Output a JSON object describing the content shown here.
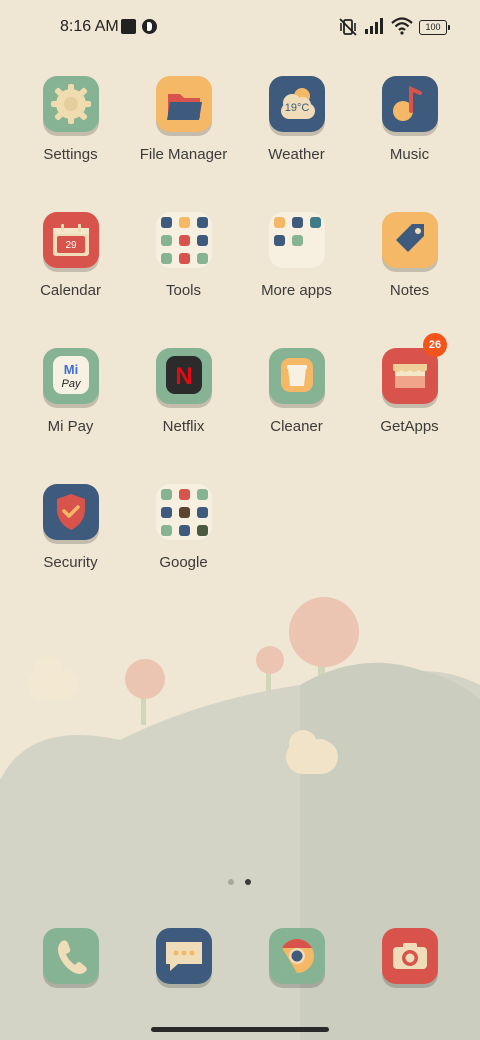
{
  "status_bar": {
    "time": "8:16 AM",
    "battery": "100",
    "icons": [
      "stop-square-icon",
      "circle-app-icon",
      "vibrate-off-icon",
      "signal-icon",
      "wifi-icon",
      "battery-icon"
    ]
  },
  "apps": [
    {
      "label": "Settings",
      "icon": "gear-icon"
    },
    {
      "label": "File Manager",
      "icon": "folder-icon"
    },
    {
      "label": "Weather",
      "icon": "cloud-icon",
      "temp": "19°C"
    },
    {
      "label": "Music",
      "icon": "music-note-icon"
    },
    {
      "label": "Calendar",
      "icon": "calendar-icon",
      "date": "29"
    },
    {
      "label": "Tools",
      "icon": "folder-grid-icon"
    },
    {
      "label": "More apps",
      "icon": "folder-grid-icon"
    },
    {
      "label": "Notes",
      "icon": "tag-icon"
    },
    {
      "label": "Mi Pay",
      "icon": "mi-pay-icon",
      "logo_top": "Mi",
      "logo_bottom": "Pay"
    },
    {
      "label": "Netflix",
      "icon": "netflix-icon",
      "logo": "N"
    },
    {
      "label": "Cleaner",
      "icon": "trash-icon"
    },
    {
      "label": "GetApps",
      "icon": "store-icon",
      "badge": "26"
    },
    {
      "label": "Security",
      "icon": "shield-icon"
    },
    {
      "label": "Google",
      "icon": "folder-grid-icon"
    }
  ],
  "dock": [
    {
      "name": "Phone",
      "icon": "phone-icon"
    },
    {
      "name": "Messages",
      "icon": "message-icon"
    },
    {
      "name": "Chrome",
      "icon": "chrome-icon"
    },
    {
      "name": "Camera",
      "icon": "camera-icon"
    }
  ],
  "page_indicator": {
    "pages": 2,
    "current": 2
  },
  "colors": {
    "background": "#efe6d3",
    "green_icon": "#86b393",
    "navy_icon": "#3e5a7c",
    "orange_icon": "#f4b866",
    "red_icon": "#d9534d",
    "badge": "#f2541b"
  }
}
